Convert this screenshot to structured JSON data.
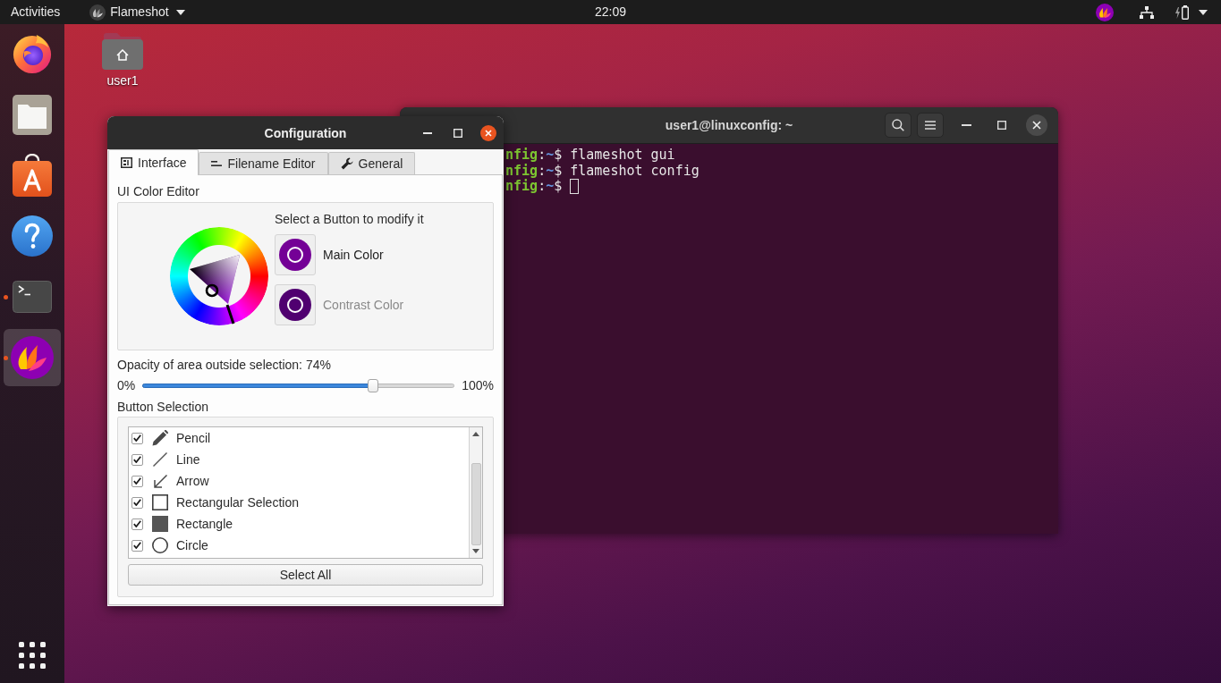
{
  "top_bar": {
    "activities": "Activities",
    "app_menu": "Flameshot",
    "clock": "22:09"
  },
  "dock": {
    "items": [
      {
        "running": false,
        "selected": false
      },
      {
        "running": false,
        "selected": false
      },
      {
        "running": false,
        "selected": false
      },
      {
        "running": false,
        "selected": false
      },
      {
        "running": true,
        "selected": false
      },
      {
        "running": true,
        "selected": true
      }
    ]
  },
  "desktop": {
    "icons": [
      {
        "label": "user1"
      }
    ]
  },
  "terminal": {
    "title": "user1@linuxconfig: ~",
    "lines": [
      {
        "segments": [
          {
            "kind": "host",
            "text": "nfig"
          },
          {
            "kind": "plain",
            "text": ":"
          },
          {
            "kind": "path",
            "text": "~"
          },
          {
            "kind": "plain",
            "text": "$ flameshot gui"
          }
        ],
        "cursor": false
      },
      {
        "segments": [
          {
            "kind": "host",
            "text": "nfig"
          },
          {
            "kind": "plain",
            "text": ":"
          },
          {
            "kind": "path",
            "text": "~"
          },
          {
            "kind": "plain",
            "text": "$ flameshot config"
          }
        ],
        "cursor": false
      },
      {
        "segments": [
          {
            "kind": "host",
            "text": "nfig"
          },
          {
            "kind": "plain",
            "text": ":"
          },
          {
            "kind": "path",
            "text": "~"
          },
          {
            "kind": "plain",
            "text": "$"
          }
        ],
        "cursor": true
      }
    ]
  },
  "configuration": {
    "title": "Configuration",
    "tabs": [
      {
        "label": "Interface",
        "selected": true
      },
      {
        "label": "Filename Editor",
        "selected": false
      },
      {
        "label": "General",
        "selected": false
      }
    ],
    "color_editor": {
      "heading": "UI Color Editor",
      "prompt": "Select a Button to modify it",
      "buttons": [
        {
          "label": "Main Color",
          "color": "#740096",
          "selected": true
        },
        {
          "label": "Contrast Color",
          "color": "#500070",
          "selected": false
        }
      ]
    },
    "opacity": {
      "label": "Opacity of area outside selection: 74%",
      "min_label": "0%",
      "max_label": "100%",
      "level": 0.74
    },
    "button_selection": {
      "heading": "Button Selection",
      "items": [
        {
          "label": "Pencil",
          "checked": true
        },
        {
          "label": "Line",
          "checked": true
        },
        {
          "label": "Arrow",
          "checked": true
        },
        {
          "label": "Rectangular Selection",
          "checked": true
        },
        {
          "label": "Rectangle",
          "checked": true
        },
        {
          "label": "Circle",
          "checked": true
        }
      ],
      "select_all": "Select All"
    }
  }
}
